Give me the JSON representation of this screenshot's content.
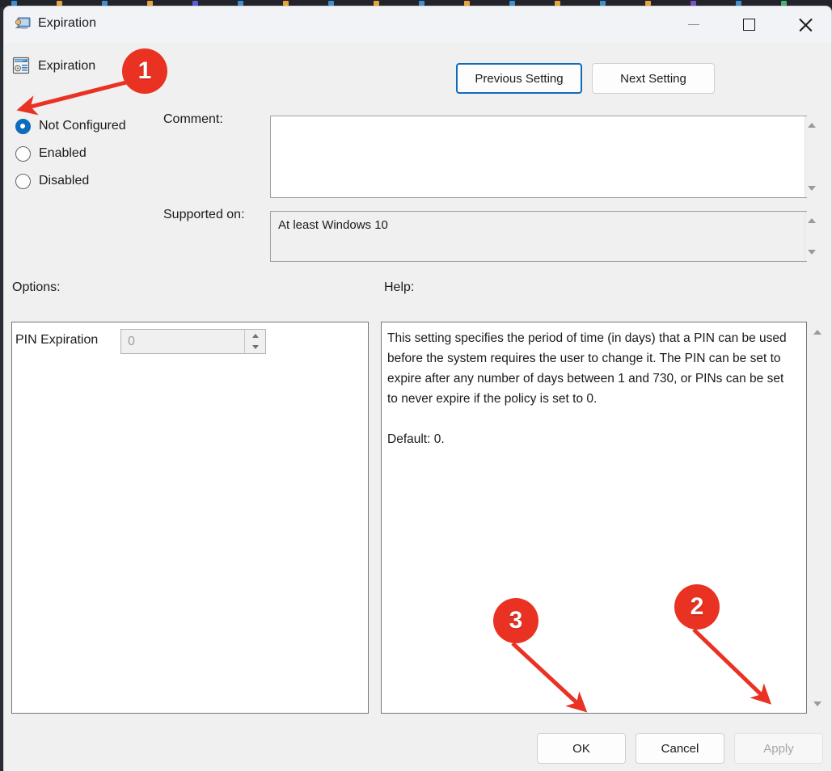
{
  "window": {
    "title": "Expiration",
    "icon": "policy-computer-icon",
    "controls": {
      "minimize": "minimize-icon",
      "maximize": "maximize-icon",
      "close": "close-icon"
    }
  },
  "header": {
    "policy_icon": "policy-setting-icon",
    "policy_name": "Expiration",
    "previous_setting_label": "Previous Setting",
    "next_setting_label": "Next Setting"
  },
  "state_radios": {
    "selected": "Not Configured",
    "options": [
      {
        "label": "Not Configured",
        "checked": true
      },
      {
        "label": "Enabled",
        "checked": false
      },
      {
        "label": "Disabled",
        "checked": false
      }
    ]
  },
  "labels": {
    "comment": "Comment:",
    "supported_on": "Supported on:",
    "options": "Options:",
    "help": "Help:"
  },
  "comment_field": {
    "value": "",
    "placeholder": ""
  },
  "supported_on_field": {
    "value": "At least Windows 10"
  },
  "options_panel": {
    "pin_expiration_label": "PIN Expiration",
    "pin_expiration_value": "0",
    "enabled": false
  },
  "help_panel": {
    "text": "This setting specifies the period of time (in days) that a PIN can be used before the system requires the user to change it. The PIN can be set to expire after any number of days between 1 and 730, or PINs can be set to never expire if the policy is set to 0.\n\nDefault: 0."
  },
  "footer": {
    "ok_label": "OK",
    "cancel_label": "Cancel",
    "apply_label": "Apply",
    "apply_enabled": false
  },
  "annotations": [
    {
      "number": "1",
      "target": "not-configured-radio"
    },
    {
      "number": "2",
      "target": "apply-button"
    },
    {
      "number": "3",
      "target": "ok-button"
    }
  ],
  "colors": {
    "accent": "#0f6cbd",
    "annotation": "#ea3223",
    "dialog_bg": "#f0f0f0",
    "titlebar_bg": "#f2f3f7"
  }
}
